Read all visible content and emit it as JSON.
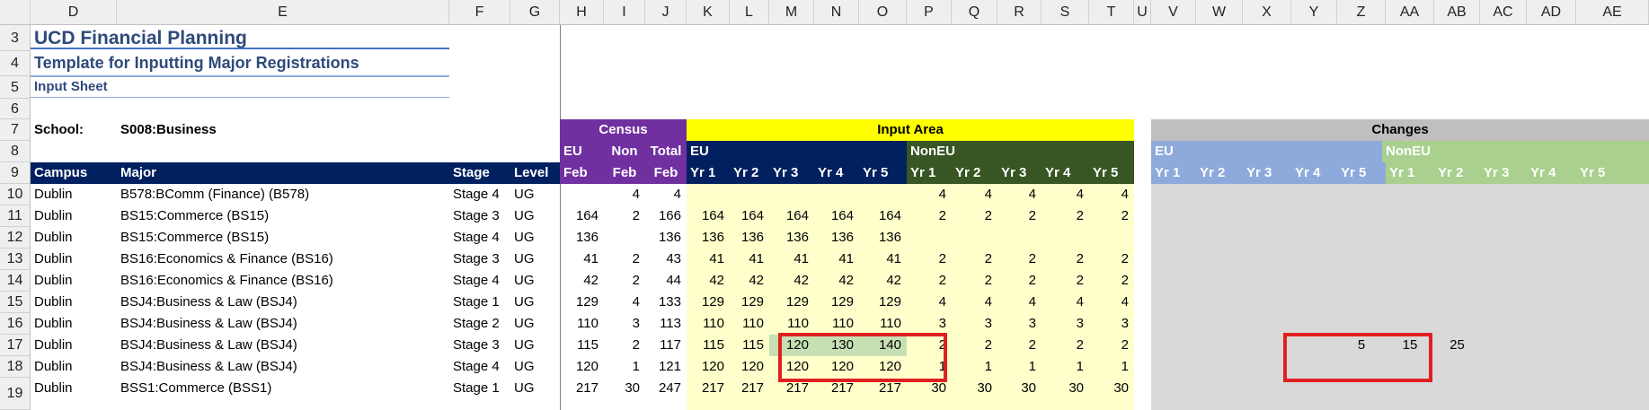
{
  "column_letters": [
    "D",
    "E",
    "F",
    "G",
    "H",
    "I",
    "J",
    "K",
    "L",
    "M",
    "N",
    "O",
    "P",
    "Q",
    "R",
    "S",
    "T",
    "U",
    "V",
    "W",
    "X",
    "Y",
    "Z",
    "AA",
    "AB",
    "AC",
    "AD",
    "AE"
  ],
  "row_numbers": [
    "3",
    "4",
    "5",
    "6",
    "7",
    "8",
    "9",
    "10",
    "11",
    "12",
    "13",
    "14",
    "15",
    "16",
    "17",
    "18",
    "19"
  ],
  "titles": {
    "main": "UCD Financial Planning",
    "sub": "Template for Inputting Major Registrations",
    "sheet": "Input Sheet"
  },
  "school": {
    "label": "School:",
    "value": "S008:Business"
  },
  "groups": {
    "census": "Census",
    "input_area": "Input Area",
    "changes": "Changes"
  },
  "subgroups": {
    "eu": "EU",
    "non": "Non",
    "total": "Total",
    "input_eu": "EU",
    "input_noneu": "NonEU",
    "changes_eu": "EU",
    "changes_noneu": "NonEU"
  },
  "headers": {
    "campus": "Campus",
    "major": "Major",
    "stage": "Stage",
    "level": "Level",
    "census_feb": [
      "Feb",
      "Feb",
      "Feb"
    ],
    "years": [
      "Yr 1",
      "Yr 2",
      "Yr 3",
      "Yr 4",
      "Yr 5",
      "Yr 1",
      "Yr 2",
      "Yr 3",
      "Yr 4",
      "Yr 5"
    ],
    "change_years": [
      "Yr 1",
      "Yr 2",
      "Yr 3",
      "Yr 4",
      "Yr 5",
      "Yr 1",
      "Yr 2",
      "Yr 3",
      "Yr 4",
      "Yr 5"
    ]
  },
  "rows": [
    {
      "campus": "Dublin",
      "major": "B578:BComm (Finance) (B578)",
      "stage": "Stage 4",
      "level": "UG",
      "census": [
        "",
        "4",
        "4"
      ],
      "eu": [
        "",
        "",
        "",
        "",
        ""
      ],
      "noneu": [
        "4",
        "4",
        "4",
        "4",
        "4"
      ],
      "changes": [
        "",
        "",
        ""
      ]
    },
    {
      "campus": "Dublin",
      "major": "BS15:Commerce (BS15)",
      "stage": "Stage 3",
      "level": "UG",
      "census": [
        "164",
        "2",
        "166"
      ],
      "eu": [
        "164",
        "164",
        "164",
        "164",
        "164"
      ],
      "noneu": [
        "2",
        "2",
        "2",
        "2",
        "2"
      ],
      "changes": [
        "",
        "",
        ""
      ]
    },
    {
      "campus": "Dublin",
      "major": "BS15:Commerce (BS15)",
      "stage": "Stage 4",
      "level": "UG",
      "census": [
        "136",
        "",
        "136"
      ],
      "eu": [
        "136",
        "136",
        "136",
        "136",
        "136"
      ],
      "noneu": [
        "",
        "",
        "",
        "",
        ""
      ],
      "changes": [
        "",
        "",
        ""
      ]
    },
    {
      "campus": "Dublin",
      "major": "BS16:Economics & Finance (BS16)",
      "stage": "Stage 3",
      "level": "UG",
      "census": [
        "41",
        "2",
        "43"
      ],
      "eu": [
        "41",
        "41",
        "41",
        "41",
        "41"
      ],
      "noneu": [
        "2",
        "2",
        "2",
        "2",
        "2"
      ],
      "changes": [
        "",
        "",
        ""
      ]
    },
    {
      "campus": "Dublin",
      "major": "BS16:Economics & Finance (BS16)",
      "stage": "Stage 4",
      "level": "UG",
      "census": [
        "42",
        "2",
        "44"
      ],
      "eu": [
        "42",
        "42",
        "42",
        "42",
        "42"
      ],
      "noneu": [
        "2",
        "2",
        "2",
        "2",
        "2"
      ],
      "changes": [
        "",
        "",
        ""
      ]
    },
    {
      "campus": "Dublin",
      "major": "BSJ4:Business & Law (BSJ4)",
      "stage": "Stage 1",
      "level": "UG",
      "census": [
        "129",
        "4",
        "133"
      ],
      "eu": [
        "129",
        "129",
        "129",
        "129",
        "129"
      ],
      "noneu": [
        "4",
        "4",
        "4",
        "4",
        "4"
      ],
      "changes": [
        "",
        "",
        ""
      ]
    },
    {
      "campus": "Dublin",
      "major": "BSJ4:Business & Law (BSJ4)",
      "stage": "Stage 2",
      "level": "UG",
      "census": [
        "110",
        "3",
        "113"
      ],
      "eu": [
        "110",
        "110",
        "110",
        "110",
        "110"
      ],
      "noneu": [
        "3",
        "3",
        "3",
        "3",
        "3"
      ],
      "changes": [
        "",
        "",
        ""
      ]
    },
    {
      "campus": "Dublin",
      "major": "BSJ4:Business & Law (BSJ4)",
      "stage": "Stage 3",
      "level": "UG",
      "census": [
        "115",
        "2",
        "117"
      ],
      "eu": [
        "115",
        "115",
        "120",
        "130",
        "140"
      ],
      "noneu": [
        "2",
        "2",
        "2",
        "2",
        "2"
      ],
      "changes": [
        "5",
        "15",
        "25"
      ]
    },
    {
      "campus": "Dublin",
      "major": "BSJ4:Business & Law (BSJ4)",
      "stage": "Stage 4",
      "level": "UG",
      "census": [
        "120",
        "1",
        "121"
      ],
      "eu": [
        "120",
        "120",
        "120",
        "120",
        "120"
      ],
      "noneu": [
        "1",
        "1",
        "1",
        "1",
        "1"
      ],
      "changes": [
        "",
        "",
        ""
      ]
    },
    {
      "campus": "Dublin",
      "major": "BSS1:Commerce (BSS1)",
      "stage": "Stage 1",
      "level": "UG",
      "census": [
        "217",
        "30",
        "247"
      ],
      "eu": [
        "217",
        "217",
        "217",
        "217",
        "217"
      ],
      "noneu": [
        "30",
        "30",
        "30",
        "30",
        "30"
      ],
      "changes": [
        "",
        "",
        ""
      ]
    }
  ],
  "colors": {
    "census_purple": "#7030a0",
    "input_yellow": "#ffff00",
    "navy": "#002060",
    "dark_green": "#375623",
    "input_fill": "#ffffcc",
    "edited_fill": "#c6e0b4",
    "changes_gray": "#d9d9d9",
    "changes_eu": "#8ea9db",
    "changes_noneu": "#a9d08e",
    "highlight": "#e02020"
  }
}
